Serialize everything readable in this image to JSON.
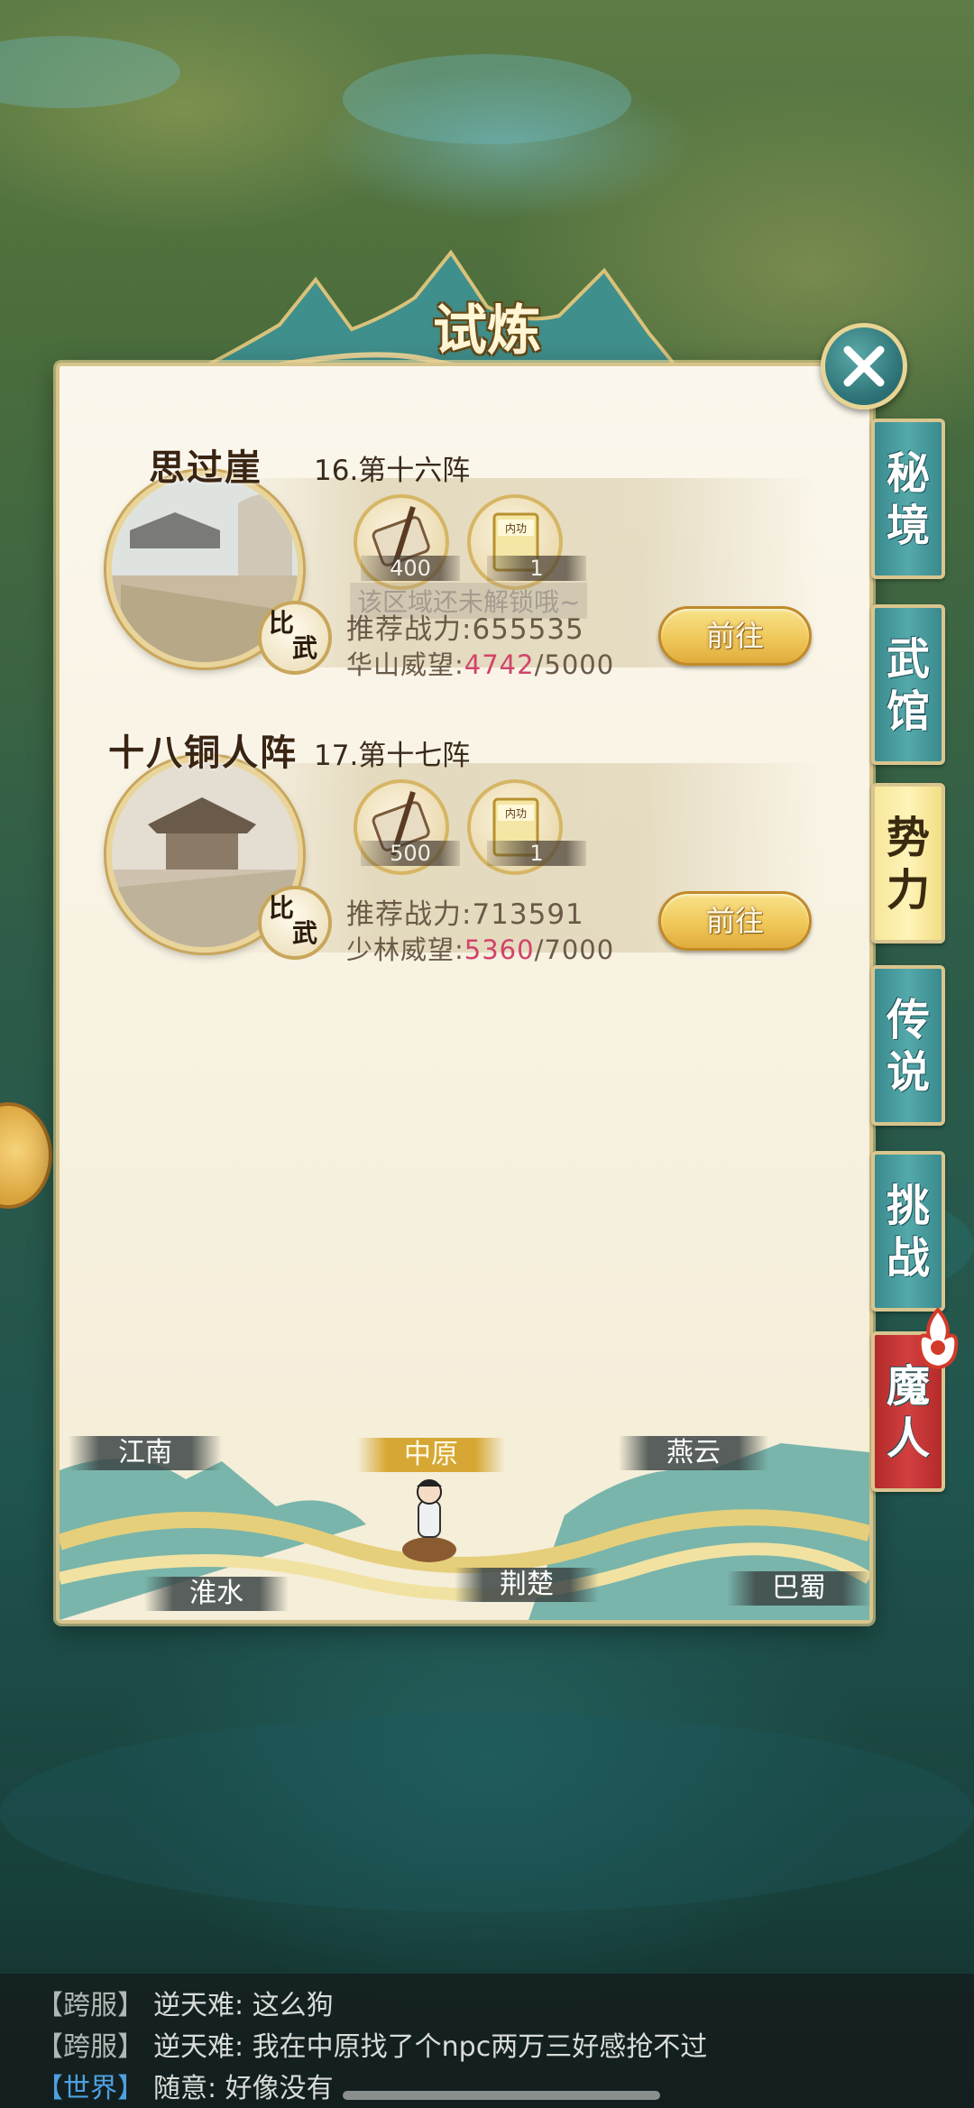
{
  "title": "试炼",
  "tabs": [
    {
      "label": "秘境",
      "active": false
    },
    {
      "label": "武馆",
      "active": false
    },
    {
      "label": "势力",
      "active": true
    },
    {
      "label": "传说",
      "active": false
    },
    {
      "label": "挑战",
      "active": false
    },
    {
      "label": "魔人",
      "active": false
    }
  ],
  "entries": [
    {
      "name": "思过崖",
      "stage": "16.第十六阵",
      "badge": "比武",
      "rewards": [
        {
          "icon": "scroll-icon",
          "count": "400"
        },
        {
          "icon": "book-icon",
          "count": "1"
        }
      ],
      "locked_text": "该区域还未解锁哦~",
      "power_label": "推荐战力:655535",
      "reputation_label": "华山威望:",
      "reputation_current": "4742",
      "reputation_max": "/5000",
      "go_label": "前往"
    },
    {
      "name": "十八铜人阵",
      "stage": "17.第十七阵",
      "badge": "比武",
      "rewards": [
        {
          "icon": "scroll-icon",
          "count": "500"
        },
        {
          "icon": "book-icon",
          "count": "1"
        }
      ],
      "power_label": "推荐战力:713591",
      "reputation_label": "少林威望:",
      "reputation_current": "5360",
      "reputation_max": "/7000",
      "go_label": "前往"
    }
  ],
  "book_cover_text": "内功",
  "regions": [
    {
      "label": "江南",
      "active": false
    },
    {
      "label": "中原",
      "active": true
    },
    {
      "label": "燕云",
      "active": false
    },
    {
      "label": "淮水",
      "active": false
    },
    {
      "label": "荆楚",
      "active": false
    },
    {
      "label": "巴蜀",
      "active": false
    }
  ],
  "chat": [
    {
      "channel": "【跨服】",
      "sender": "逆天难:",
      "text": "这么狗",
      "world": false
    },
    {
      "channel": "【跨服】",
      "sender": "逆天难:",
      "text": "我在中原找了个npc两万三好感抢不过",
      "world": false
    },
    {
      "channel": "【世界】",
      "sender": "随意:",
      "text": "好像没有",
      "world": true
    }
  ],
  "colors": {
    "accent_teal": "#3a8a8e",
    "gold": "#f0c85a",
    "reputation_highlight": "#d2436a",
    "demon_tab_red": "#b42a2a"
  }
}
